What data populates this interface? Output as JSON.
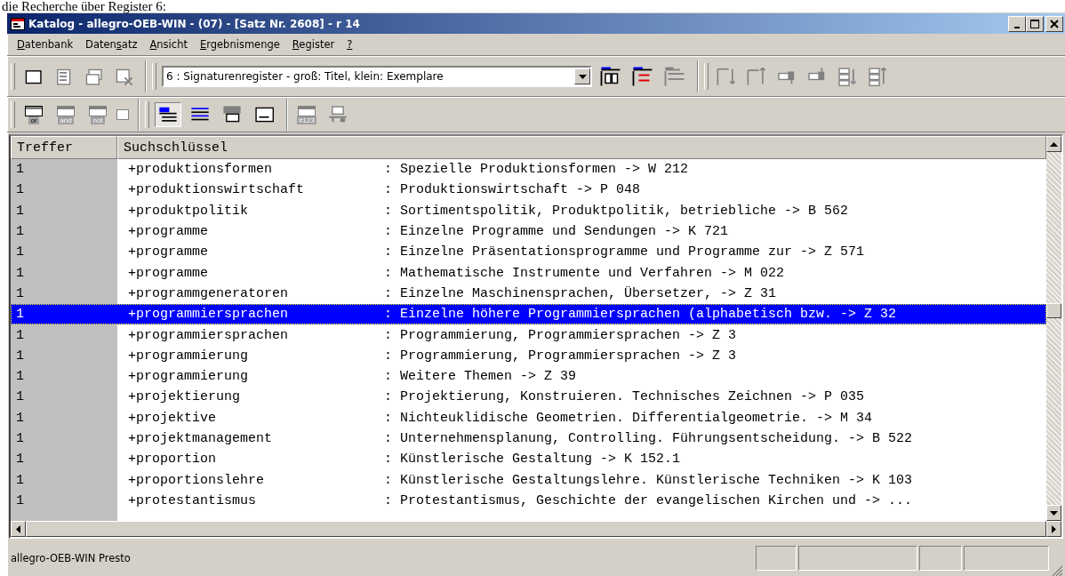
{
  "page_text": "die Recherche über Register 6:",
  "window": {
    "title": "Katalog - allegro-OEB-WIN - (07) - [Satz Nr. 2608] - r 14"
  },
  "menu": [
    {
      "key": "D",
      "post": "atenbank"
    },
    {
      "pre": "Daten",
      "key": "s",
      "post": "atz"
    },
    {
      "key": "A",
      "post": "nsicht"
    },
    {
      "key": "E",
      "post": "rgebnismenge"
    },
    {
      "key": "R",
      "post": "egister"
    },
    {
      "key": "?"
    }
  ],
  "toolbar_1": {
    "record_buttons": [
      {
        "disabled": false
      },
      {
        "disabled": true
      },
      {
        "disabled": true
      },
      {
        "disabled": true
      }
    ],
    "register_select": {
      "value": "6 : Signaturenregister - groß: Titel, klein: Exemplare"
    },
    "list_buttons": [
      {
        "disabled": false
      },
      {
        "disabled": false
      },
      {
        "disabled": true
      }
    ],
    "move_buttons": [
      {
        "disabled": true
      },
      {
        "disabled": true
      },
      {
        "disabled": true
      },
      {
        "disabled": true
      },
      {
        "disabled": true
      },
      {
        "disabled": true
      }
    ]
  },
  "toolbar_2": {
    "logic_buttons": [
      {
        "label": "or",
        "disabled": false
      },
      {
        "label": "and",
        "disabled": true
      },
      {
        "label": "not",
        "disabled": true
      }
    ],
    "view_buttons": [
      {
        "selected": true
      },
      {
        "selected": false
      },
      {
        "selected": false
      },
      {
        "selected": false
      }
    ],
    "number_button": {
      "label": "#123",
      "disabled": true
    }
  },
  "table": {
    "columns": [
      "Treffer",
      "Suchschlüssel"
    ],
    "rows": [
      {
        "hits": "1",
        "key": "+produktionsformen",
        "text": ": Spezielle Produktionsformen -> W 212",
        "selected": false
      },
      {
        "hits": "1",
        "key": "+produktionswirtschaft",
        "text": ": Produktionswirtschaft -> P 048",
        "selected": false
      },
      {
        "hits": "1",
        "key": "+produktpolitik",
        "text": ": Sortimentspolitik, Produktpolitik, betriebliche -> B 562",
        "selected": false
      },
      {
        "hits": "1",
        "key": "+programme",
        "text": ": Einzelne Programme und Sendungen -> K 721",
        "selected": false
      },
      {
        "hits": "1",
        "key": "+programme",
        "text": ": Einzelne Präsentationsprogramme und Programme zur -> Z 571",
        "selected": false
      },
      {
        "hits": "1",
        "key": "+programme",
        "text": ": Mathematische Instrumente und Verfahren -> M 022",
        "selected": false
      },
      {
        "hits": "1",
        "key": "+programmgeneratoren",
        "text": ": Einzelne Maschinensprachen, Übersetzer, -> Z 31",
        "selected": false
      },
      {
        "hits": "1",
        "key": "+programmiersprachen",
        "text": ": Einzelne höhere Programmiersprachen (alphabetisch bzw. -> Z 32",
        "selected": true
      },
      {
        "hits": "1",
        "key": "+programmiersprachen",
        "text": ": Programmierung, Programmiersprachen -> Z 3",
        "selected": false
      },
      {
        "hits": "1",
        "key": "+programmierung",
        "text": ": Programmierung, Programmiersprachen -> Z 3",
        "selected": false
      },
      {
        "hits": "1",
        "key": "+programmierung",
        "text": ": Weitere Themen -> Z 39",
        "selected": false
      },
      {
        "hits": "1",
        "key": "+projektierung",
        "text": ": Projektierung, Konstruieren. Technisches Zeichnen -> P 035",
        "selected": false
      },
      {
        "hits": "1",
        "key": "+projektive",
        "text": ": Nichteuklidische Geometrien. Differentialgeometrie. -> M 34",
        "selected": false
      },
      {
        "hits": "1",
        "key": "+projektmanagement",
        "text": ": Unternehmensplanung, Controlling. Führungsentscheidung. -> B 522",
        "selected": false
      },
      {
        "hits": "1",
        "key": "+proportion",
        "text": ": Künstlerische Gestaltung -> K 152.1",
        "selected": false
      },
      {
        "hits": "1",
        "key": "+proportionslehre",
        "text": ": Künstlerische Gestaltungslehre. Künstlerische Techniken -> K 103",
        "selected": false
      },
      {
        "hits": "1",
        "key": "+protestantismus",
        "text": ": Protestantismus, Geschichte der evangelischen Kirchen und -> ...",
        "selected": false
      }
    ]
  },
  "status_bar": {
    "text": "allegro-OEB-WIN Presto"
  }
}
